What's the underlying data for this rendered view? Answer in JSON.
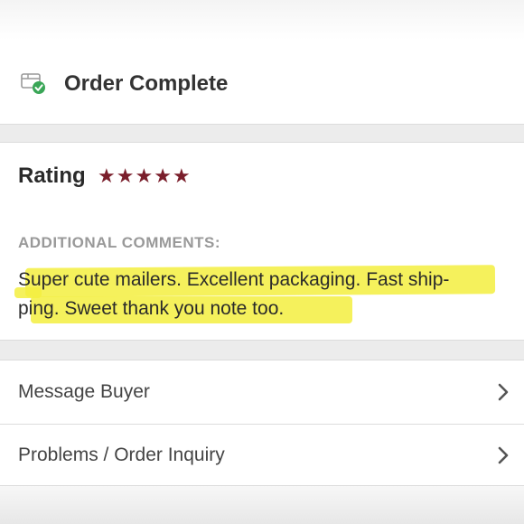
{
  "order": {
    "status_title": "Order Complete",
    "icon": "package-check-icon"
  },
  "rating": {
    "label": "Rating",
    "stars": 5,
    "max_stars": 5,
    "star_color": "#7a1e2b"
  },
  "comments": {
    "heading": "ADDITIONAL COMMENTS:",
    "line1": "Super cute mailers. Excellent packaging. Fast ship-",
    "line2": "ping. Sweet thank you note too.",
    "highlight_color": "#f3ee3f"
  },
  "actions": {
    "message_buyer": "Message Buyer",
    "problems_inquiry": "Problems / Order Inquiry"
  }
}
